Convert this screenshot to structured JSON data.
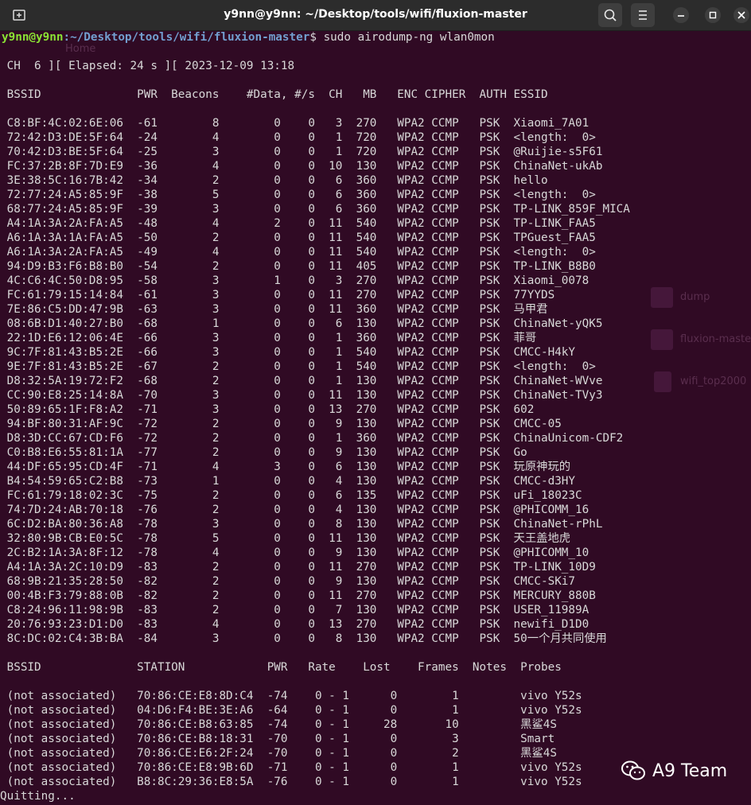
{
  "window": {
    "title": "y9nn@y9nn: ~/Desktop/tools/wifi/fluxion-master"
  },
  "terminal": {
    "prompt_user": "y9nn@y9nn",
    "prompt_path": ":~/Desktop/tools/wifi/fluxion-master",
    "prompt_symbol": "$ ",
    "command": "sudo airodump-ng wlan0mon",
    "status_line": " CH  6 ][ Elapsed: 24 s ][ 2023-12-09 13:18",
    "ap_header": " BSSID              PWR  Beacons    #Data, #/s  CH   MB   ENC CIPHER  AUTH ESSID",
    "ap_rows": [
      " C8:BF:4C:02:6E:06  -61        8        0    0   3  270   WPA2 CCMP   PSK  Xiaomi_7A01",
      " 72:42:D3:DE:5F:64  -24        4        0    0   1  720   WPA2 CCMP   PSK  <length:  0>",
      " 70:42:D3:BE:5F:64  -25        3        0    0   1  720   WPA2 CCMP   PSK  @Ruijie-s5F61",
      " FC:37:2B:8F:7D:E9  -36        4        0    0  10  130   WPA2 CCMP   PSK  ChinaNet-ukAb",
      " 3E:38:5C:16:7B:42  -34        2        0    0   6  360   WPA2 CCMP   PSK  hello",
      " 72:77:24:A5:85:9F  -38        5        0    0   6  360   WPA2 CCMP   PSK  <length:  0>",
      " 68:77:24:A5:85:9F  -39        3        0    0   6  360   WPA2 CCMP   PSK  TP-LINK_859F_MICA",
      " A4:1A:3A:2A:FA:A5  -48        4        2    0  11  540   WPA2 CCMP   PSK  TP-LINK_FAA5",
      " A6:1A:3A:1A:FA:A5  -50        2        0    0  11  540   WPA2 CCMP   PSK  TPGuest_FAA5",
      " A6:1A:3A:2A:FA:A5  -49        4        0    0  11  540   WPA2 CCMP   PSK  <length:  0>",
      " 94:D9:B3:F6:B8:B0  -54        2        0    0  11  405   WPA2 CCMP   PSK  TP-LINK_B8B0",
      " 4C:C6:4C:50:D8:95  -58        3        1    0   3  270   WPA2 CCMP   PSK  Xiaomi_0078",
      " FC:61:79:15:14:84  -61        3        0    0  11  270   WPA2 CCMP   PSK  77YYDS",
      " 7E:86:C5:DD:47:9B  -63        3        0    0  11  360   WPA2 CCMP   PSK  马甲君",
      " 08:6B:D1:40:27:B0  -68        1        0    0   6  130   WPA2 CCMP   PSK  ChinaNet-yQK5",
      " 22:1D:E6:12:06:4E  -66        3        0    0   1  360   WPA2 CCMP   PSK  菲哥",
      " 9C:7F:81:43:B5:2E  -66        3        0    0   1  540   WPA2 CCMP   PSK  CMCC-H4kY",
      " 9E:7F:81:43:B5:2E  -67        2        0    0   1  540   WPA2 CCMP   PSK  <length:  0>",
      " D8:32:5A:19:72:F2  -68        2        0    0   1  130   WPA2 CCMP   PSK  ChinaNet-WVve",
      " CC:90:E8:25:14:8A  -70        3        0    0  11  130   WPA2 CCMP   PSK  ChinaNet-TVy3",
      " 50:89:65:1F:F8:A2  -71        3        0    0  13  270   WPA2 CCMP   PSK  602",
      " 94:BF:80:31:AF:9C  -72        2        0    0   9  130   WPA2 CCMP   PSK  CMCC-05",
      " D8:3D:CC:67:CD:F6  -72        2        0    0   1  360   WPA2 CCMP   PSK  ChinaUnicom-CDF2",
      " C0:B8:E6:55:81:1A  -77        2        0    0   9  130   WPA2 CCMP   PSK  Go",
      " 44:DF:65:95:CD:4F  -71        4        3    0   6  130   WPA2 CCMP   PSK  玩原神玩的",
      " B4:54:59:65:C2:B8  -73        1        0    0   4  130   WPA2 CCMP   PSK  CMCC-d3HY",
      " FC:61:79:18:02:3C  -75        2        0    0   6  135   WPA2 CCMP   PSK  uFi_18023C",
      " 74:7D:24:AB:70:18  -76        2        0    0   4  130   WPA2 CCMP   PSK  @PHICOMM_16",
      " 6C:D2:BA:80:36:A8  -78        3        0    0   8  130   WPA2 CCMP   PSK  ChinaNet-rPhL",
      " 32:80:9B:CB:E0:5C  -78        5        0    0  11  130   WPA2 CCMP   PSK  天王盖地虎",
      " 2C:B2:1A:3A:8F:12  -78        4        0    0   9  130   WPA2 CCMP   PSK  @PHICOMM_10",
      " A4:1A:3A:2C:10:D9  -83        2        0    0  11  270   WPA2 CCMP   PSK  TP-LINK_10D9",
      " 68:9B:21:35:28:50  -82        2        0    0   9  130   WPA2 CCMP   PSK  CMCC-SKi7",
      " 00:4B:F3:79:88:0B  -82        2        0    0  11  270   WPA2 CCMP   PSK  MERCURY_880B",
      " C8:24:96:11:98:9B  -83        2        0    0   7  130   WPA2 CCMP   PSK  USER_11989A",
      " 20:76:93:23:D1:D0  -83        4        0    0  13  270   WPA2 CCMP   PSK  newifi_D1D0",
      " 8C:DC:02:C4:3B:BA  -84        3        0    0   8  130   WPA2 CCMP   PSK  50一个月共同使用"
    ],
    "station_header": " BSSID              STATION            PWR   Rate    Lost    Frames  Notes  Probes",
    "station_rows": [
      " (not associated)   70:86:CE:E8:8D:C4  -74    0 - 1      0        1         vivo Y52s",
      " (not associated)   04:D6:F4:BE:3E:A6  -64    0 - 1      0        1         vivo Y52s",
      " (not associated)   70:86:CE:B8:63:85  -74    0 - 1     28       10         黑鲨4S",
      " (not associated)   70:86:CE:B8:18:31  -70    0 - 1      0        3         Smart",
      " (not associated)   70:86:CE:E6:2F:24  -70    0 - 1      0        2         黑鲨4S",
      " (not associated)   70:86:CE:E8:9B:6D  -71    0 - 1      0        1         vivo Y52s",
      " (not associated)   B8:8C:29:36:E8:5A  -76    0 - 1      0        1         vivo Y52s"
    ],
    "footer": "Quitting..."
  },
  "background_ghost": {
    "home": "Home",
    "folders": [
      "dump",
      "fluxion-maste",
      "wifi_top2000"
    ]
  },
  "watermark": {
    "text": "A9 Team"
  }
}
